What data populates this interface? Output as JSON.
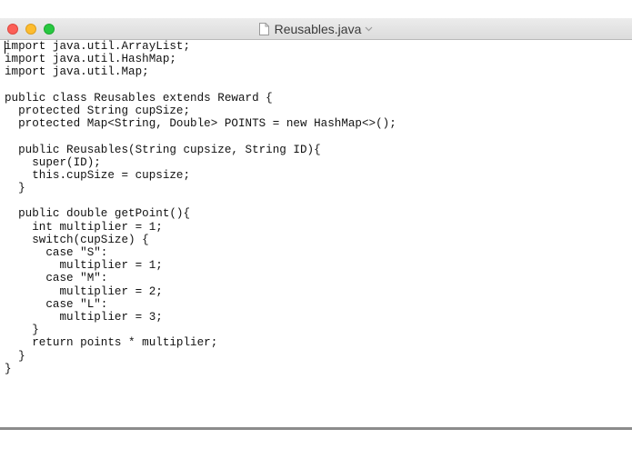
{
  "window": {
    "title": "Reusables.java"
  },
  "icons": {
    "document": "document-icon",
    "chevron": "chevron-down-icon"
  },
  "colors": {
    "close": "#fc5f57",
    "minimize": "#fdbc2e",
    "zoom": "#28c840"
  },
  "editor": {
    "lines": [
      "import java.util.ArrayList;",
      "import java.util.HashMap;",
      "import java.util.Map;",
      "",
      "public class Reusables extends Reward {",
      "  protected String cupSize;",
      "  protected Map<String, Double> POINTS = new HashMap<>();",
      "",
      "  public Reusables(String cupsize, String ID){",
      "    super(ID);",
      "    this.cupSize = cupsize;",
      "  }",
      "",
      "  public double getPoint(){",
      "    int multiplier = 1;",
      "    switch(cupSize) {",
      "      case \"S\":",
      "        multiplier = 1;",
      "      case \"M\":",
      "        multiplier = 2;",
      "      case \"L\":",
      "        multiplier = 3;",
      "    }",
      "    return points * multiplier;",
      "  }",
      "}"
    ]
  }
}
